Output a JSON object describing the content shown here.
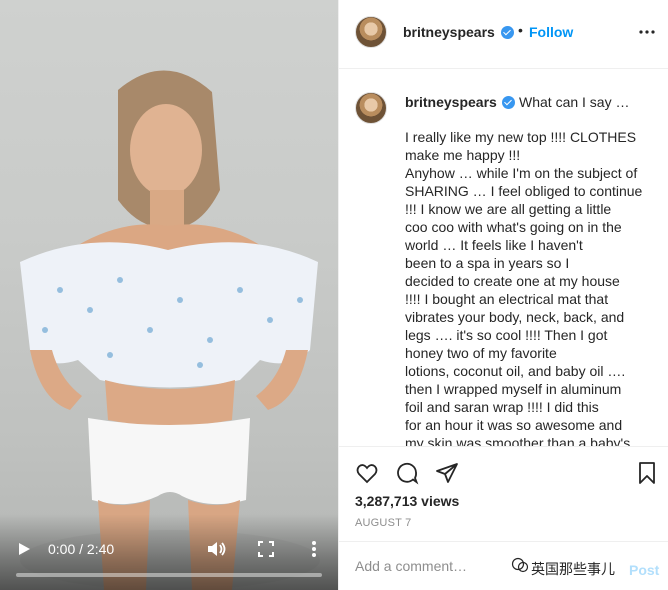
{
  "video": {
    "time_current": "0:00",
    "time_sep": " / ",
    "time_total": "2:40",
    "progress": 0.0,
    "icons": [
      "play-icon",
      "volume-icon",
      "fullscreen-icon",
      "more-vertical-icon"
    ]
  },
  "header": {
    "username": "britneyspears",
    "separator": "•",
    "follow_label": "Follow"
  },
  "caption": {
    "username": "britneyspears",
    "head": "What can I say …",
    "lines": [
      "I really like my new top !!!! CLOTHES",
      "make me happy !!!",
      "Anyhow … while I'm on the subject of",
      "SHARING … I feel obliged to continue",
      "!!! I know we are all getting a little",
      "coo coo with what's going on in the",
      "world … It feels like I haven't",
      "been to a spa in years so I",
      "decided to create one at my house",
      "!!!! I bought an electrical mat that",
      "vibrates your body, neck, back, and",
      "legs …. it's so cool !!!! Then I got",
      "honey  two of my favorite",
      "lotions, coconut oil, and baby oil ….",
      "then I wrapped myself in aluminum",
      "foil and saran wrap !!!! I did this",
      "for an hour it was so awesome and",
      "my skin was smoother than a baby's"
    ]
  },
  "actions": {
    "views": "3,287,713 views",
    "date": "AUGUST 7",
    "icons": [
      "heart-icon",
      "comment-icon",
      "share-icon",
      "bookmark-icon"
    ]
  },
  "comment": {
    "placeholder": "Add a comment…",
    "post_label": "Post",
    "watermark": "英国那些事儿"
  },
  "colors": {
    "accent": "#0095f6",
    "verified": "#3897f0",
    "text": "#262626",
    "muted": "#8e8e8e"
  }
}
